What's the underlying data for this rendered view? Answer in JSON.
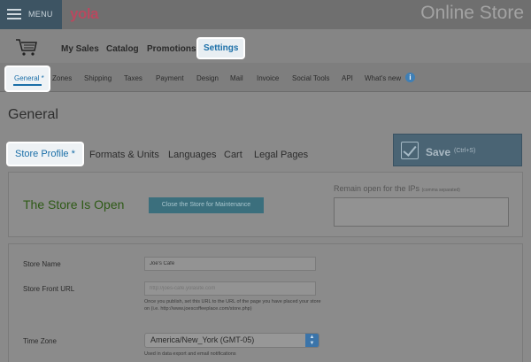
{
  "topbar": {
    "menu_label": "MENU",
    "brand": "yola",
    "product_title": "Online Store"
  },
  "mainnav": {
    "items": [
      "My Sales",
      "Catalog",
      "Promotions",
      "Settings"
    ],
    "active": "Settings"
  },
  "subnav": {
    "items": [
      "General *",
      "Zones",
      "Shipping",
      "Taxes",
      "Payment",
      "Design",
      "Mail",
      "Invoice",
      "Social Tools",
      "API",
      "What's new"
    ],
    "info_glyph": "i"
  },
  "page": {
    "title": "General"
  },
  "tabs": [
    "Store Profile *",
    "Formats & Units",
    "Languages",
    "Cart",
    "Legal Pages"
  ],
  "save": {
    "label": "Save",
    "shortcut": "(Ctrl+S)"
  },
  "store_status": {
    "title": "The Store Is Open",
    "close_button": "Close the Store for Maintenance",
    "ip_label": "Remain open for the IPs",
    "ip_label_note": "(comma separated)",
    "ip_value": ""
  },
  "form": {
    "store_name": {
      "label": "Store Name",
      "value": "Joe's Cafe"
    },
    "store_front_url": {
      "label": "Store Front URL",
      "placeholder": "http://joes-cafe.yolasite.com",
      "help": "Once you publish, set this URL to the URL of the page you have placed your store on (i.e. http://www.joescoffeeplace.com/store.php)"
    },
    "time_zone": {
      "label": "Time Zone",
      "value": "America/New_York (GMT-05)",
      "help": "Used in data export and email notifications"
    }
  }
}
